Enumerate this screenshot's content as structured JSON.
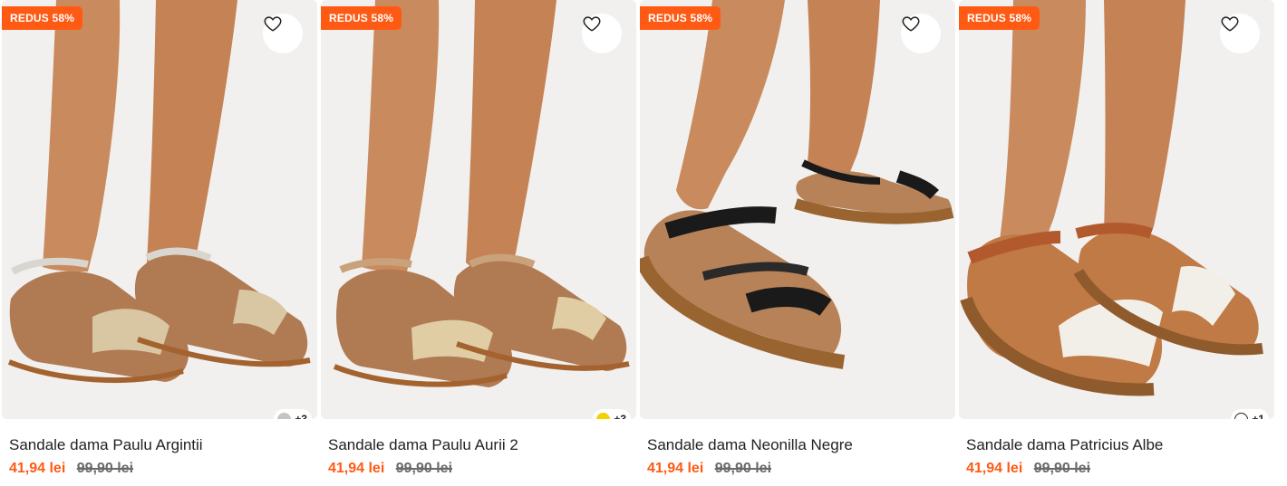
{
  "products": [
    {
      "badge": "REDUS 58%",
      "title": "Sandale dama Paulu Argintii",
      "price": "41,94 lei",
      "old_price": "99,90 lei",
      "extra_colors": "+3",
      "swatch_color": "#c4c4c4",
      "strap_color": "#d8d6cf",
      "weave_color": "#d9c7a4",
      "sole_color": "#a3622e"
    },
    {
      "badge": "REDUS 58%",
      "title": "Sandale dama Paulu Aurii 2",
      "price": "41,94 lei",
      "old_price": "99,90 lei",
      "extra_colors": "+3",
      "swatch_color": "#f5d000",
      "strap_color": "#c9a27b",
      "weave_color": "#e0cda4",
      "sole_color": "#a3622e"
    },
    {
      "badge": "REDUS 58%",
      "title": "Sandale dama Neonilla Negre",
      "price": "41,94 lei",
      "old_price": "99,90 lei",
      "extra_colors": "",
      "swatch_color": "",
      "strap_color": "#1a1a1a",
      "weave_color": "#2a2a2a",
      "sole_color": "#9a6430"
    },
    {
      "badge": "REDUS 58%",
      "title": "Sandale dama Patricius Albe",
      "price": "41,94 lei",
      "old_price": "99,90 lei",
      "extra_colors": "+1",
      "swatch_color": "#ffffff",
      "strap_color": "#b25a2e",
      "weave_color": "#f2efe8",
      "sole_color": "#8f5a2c"
    }
  ]
}
